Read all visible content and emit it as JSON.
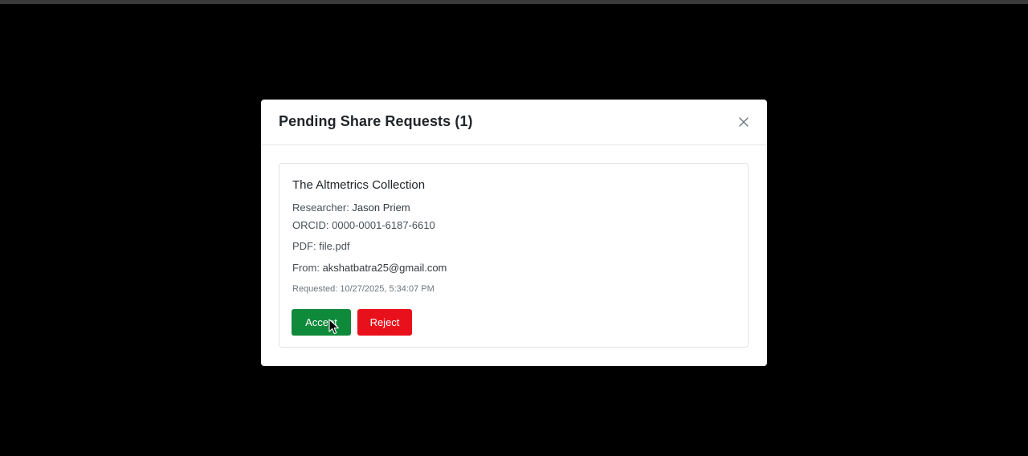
{
  "modal": {
    "title": "Pending Share Requests (1)",
    "close_icon": "close-icon"
  },
  "request": {
    "collection_title": "The Altmetrics Collection",
    "researcher_label": "Researcher: ",
    "researcher_name": "Jason Priem",
    "orcid_label": "ORCID: ",
    "orcid_value": "0000-0001-6187-6610",
    "pdf_label": "PDF: ",
    "pdf_value": "file.pdf",
    "from_label": "From: ",
    "from_value": "akshatbatra25@gmail.com",
    "requested_label": "Requested: ",
    "requested_value": "10/27/2025, 5:34:07 PM"
  },
  "actions": {
    "accept_label": "Accept",
    "reject_label": "Reject"
  },
  "colors": {
    "accept": "#0e8a3a",
    "reject": "#e8111b",
    "backdrop": "#000000"
  }
}
